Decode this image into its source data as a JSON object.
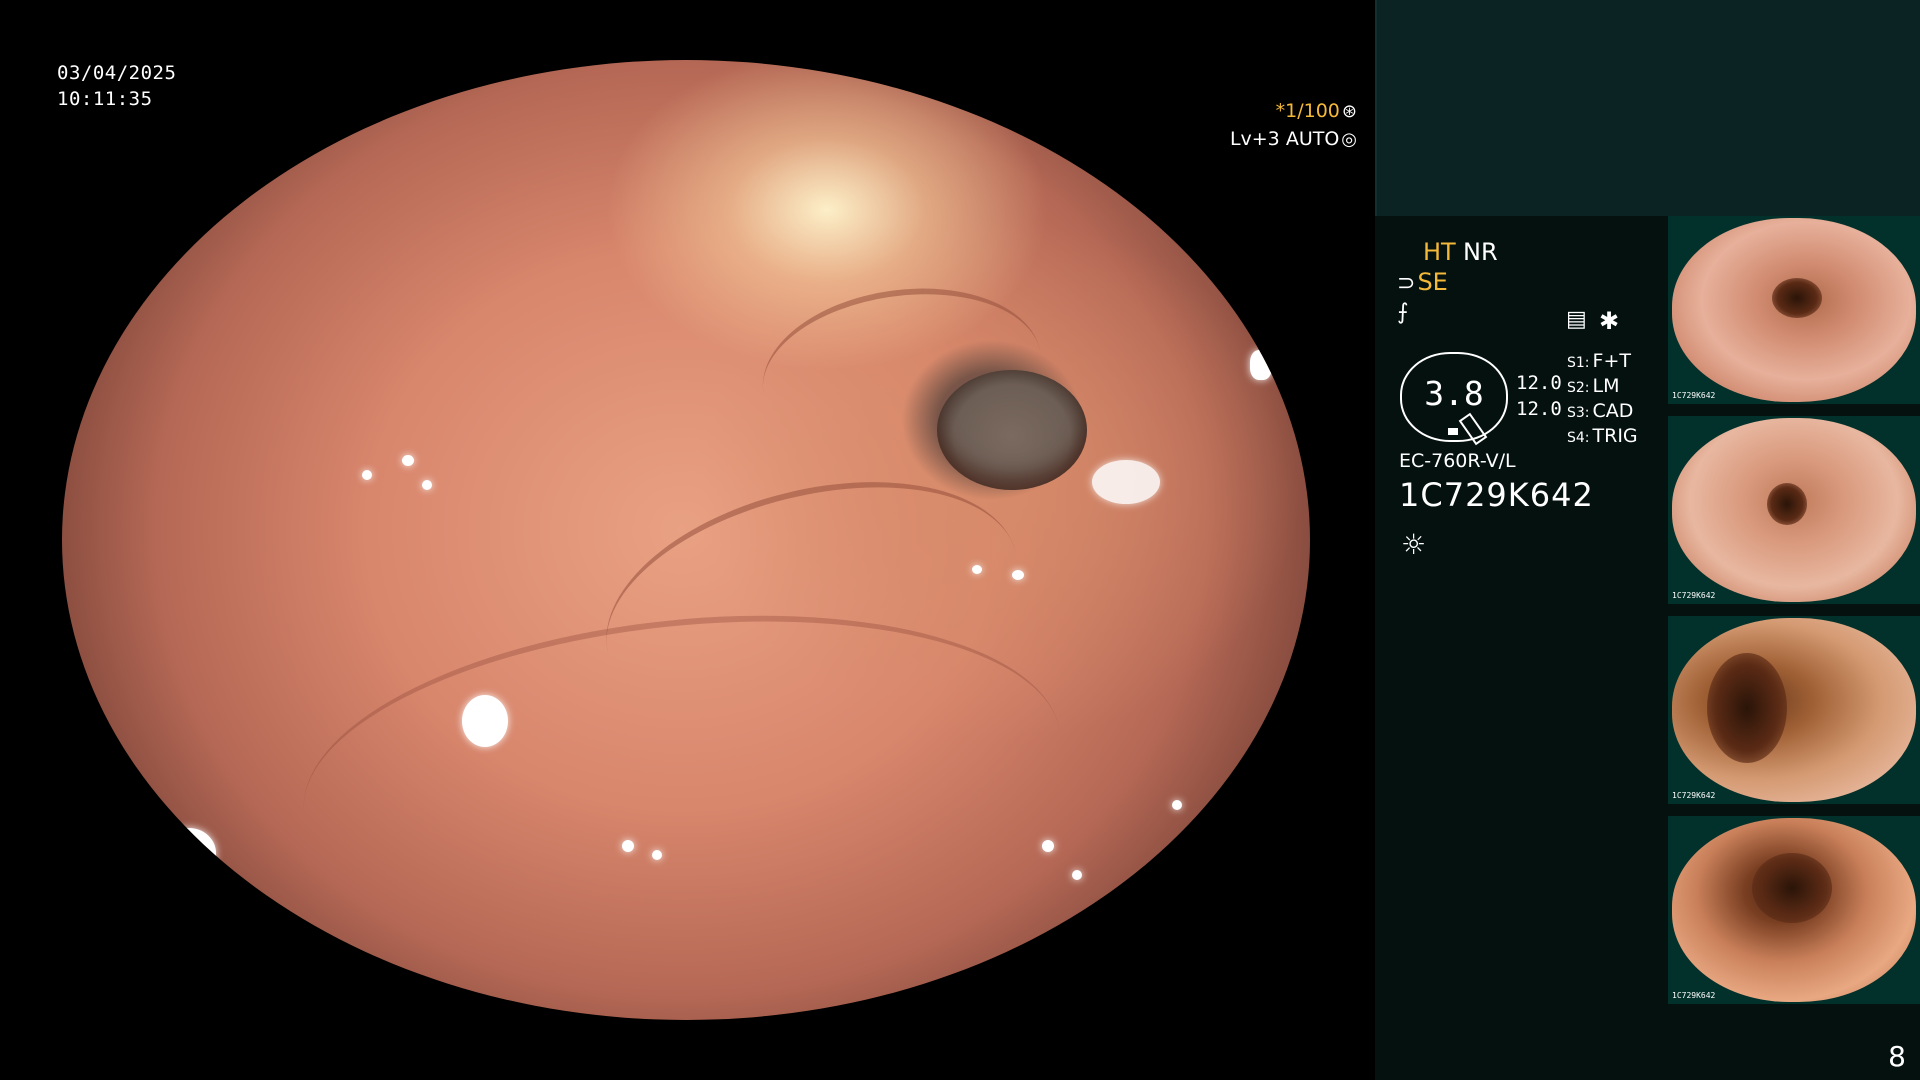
{
  "timestamp": {
    "date": "03/04/2025",
    "time": "10:11:35"
  },
  "overlay": {
    "shutter": "*1/100",
    "shutter_icon": "shutter-icon",
    "level": "Lv+3 AUTO",
    "level_icon": "auto-iris-icon"
  },
  "side_panel": {
    "mode_ht": "HT",
    "mode_nr": "NR",
    "se_label": "SE",
    "se_icon": "structure-enhance-icon",
    "f_icon": "f-curve-icon",
    "dial_value": "3.8",
    "values": [
      "12.0",
      "12.0"
    ],
    "switches": [
      {
        "key": "S1:",
        "value": "F+T"
      },
      {
        "key": "S2:",
        "value": "LM"
      },
      {
        "key": "S3:",
        "value": "CAD"
      },
      {
        "key": "S4:",
        "value": "TRIG"
      }
    ],
    "memo_icon": "memo-icon",
    "star_icon": "star-icon",
    "scope_model": "EC-760R-V/L",
    "scope_serial": "1C729K642",
    "light_icon": "light-source-icon",
    "thumbnails": [
      {
        "caption_line1": "1C729K642"
      },
      {
        "caption_line1": "1C729K642"
      },
      {
        "caption_line1": "1C729K642"
      },
      {
        "caption_line1": "1C729K642"
      }
    ],
    "page_number": "8"
  },
  "colors": {
    "accent_yellow": "#f5b93a",
    "panel_bg": "#04110f",
    "band_bg": "#0b2323"
  }
}
